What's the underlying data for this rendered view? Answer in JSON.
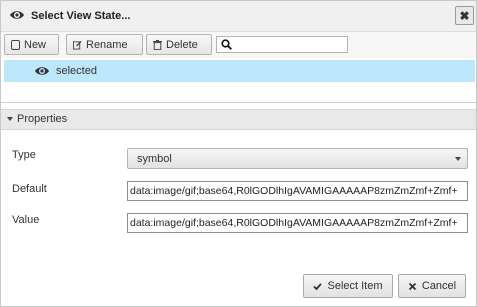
{
  "dialog": {
    "title": "Select View State...",
    "close_label": "✖"
  },
  "toolbar": {
    "new_label": "New",
    "rename_label": "Rename",
    "delete_label": "Delete",
    "search_placeholder": ""
  },
  "states": [
    {
      "label": "selected",
      "selected": true
    }
  ],
  "properties": {
    "header": "Properties",
    "type_label": "Type",
    "type_value": "symbol",
    "default_label": "Default",
    "default_value": "data:image/gif;base64,R0lGODlhIgAVAMIGAAAAAP8zmZmZmf+Zmf+",
    "value_label": "Value",
    "value_value": "data:image/gif;base64,R0lGODlhIgAVAMIGAAAAAP8zmZmZmf+Zmf+"
  },
  "footer": {
    "select_label": "Select Item",
    "cancel_label": "Cancel"
  },
  "colors": {
    "selection": "#bde7fb",
    "titlebar": "#f0f0f0"
  }
}
